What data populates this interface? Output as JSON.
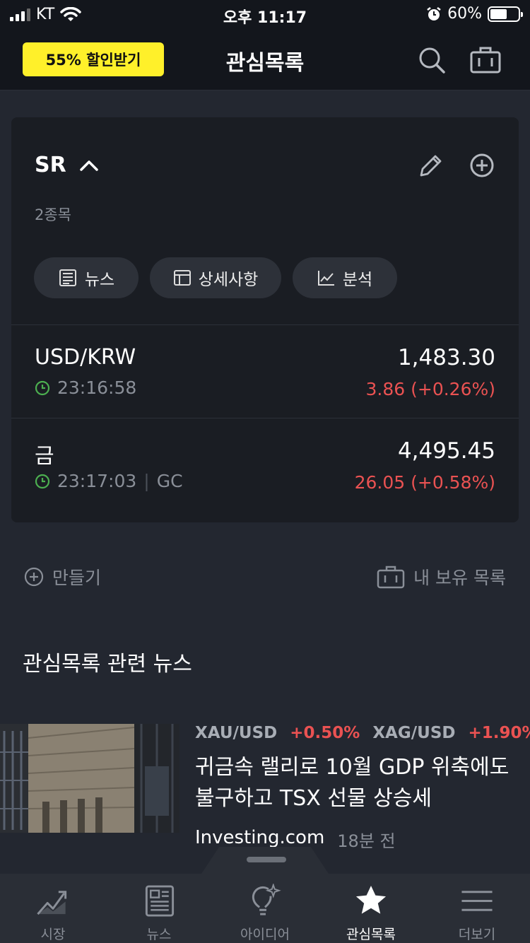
{
  "status_bar": {
    "carrier": "KT",
    "time": "오후 11:17",
    "battery_text": "60%",
    "battery_level": 0.6
  },
  "header": {
    "promo_label": "55% 할인받기",
    "title": "관심목록"
  },
  "watchlist": {
    "name": "SR",
    "count_label": "2종목",
    "pills": [
      {
        "label": "뉴스",
        "icon": "newspaper-icon"
      },
      {
        "label": "상세사항",
        "icon": "table-icon"
      },
      {
        "label": "분석",
        "icon": "chart-line-icon"
      }
    ],
    "items": [
      {
        "symbol": "USD/KRW",
        "time": "23:16:58",
        "exchange": "",
        "price": "1,483.30",
        "change": "3.86 (+0.26%)"
      },
      {
        "symbol": "금",
        "time": "23:17:03",
        "exchange": "GC",
        "price": "4,495.45",
        "change": "26.05 (+0.58%)"
      }
    ]
  },
  "actions": {
    "create_label": "만들기",
    "portfolio_label": "내 보유 목록"
  },
  "news_section": {
    "title": "관심목록 관련 뉴스",
    "article": {
      "tags": [
        {
          "symbol": "XAU/USD",
          "change": "+0.50%"
        },
        {
          "symbol": "XAG/USD",
          "change": "+1.90%"
        }
      ],
      "headline": "귀금속 랠리로 10월 GDP 위축에도 불구하고 TSX 선물 상승세",
      "source": "Investing.com",
      "ago": "18분 전"
    }
  },
  "bottom_nav": [
    {
      "label": "시장",
      "icon": "market-chart-icon",
      "active": false
    },
    {
      "label": "뉴스",
      "icon": "newspaper-icon",
      "active": false
    },
    {
      "label": "아이디어",
      "icon": "lightbulb-icon",
      "active": false
    },
    {
      "label": "관심목록",
      "icon": "star-icon",
      "active": true
    },
    {
      "label": "더보기",
      "icon": "menu-icon",
      "active": false
    }
  ],
  "colors": {
    "accent_yellow": "#fff02a",
    "up_red": "#ea5252",
    "clock_green": "#4caf50",
    "background": "#232730"
  }
}
